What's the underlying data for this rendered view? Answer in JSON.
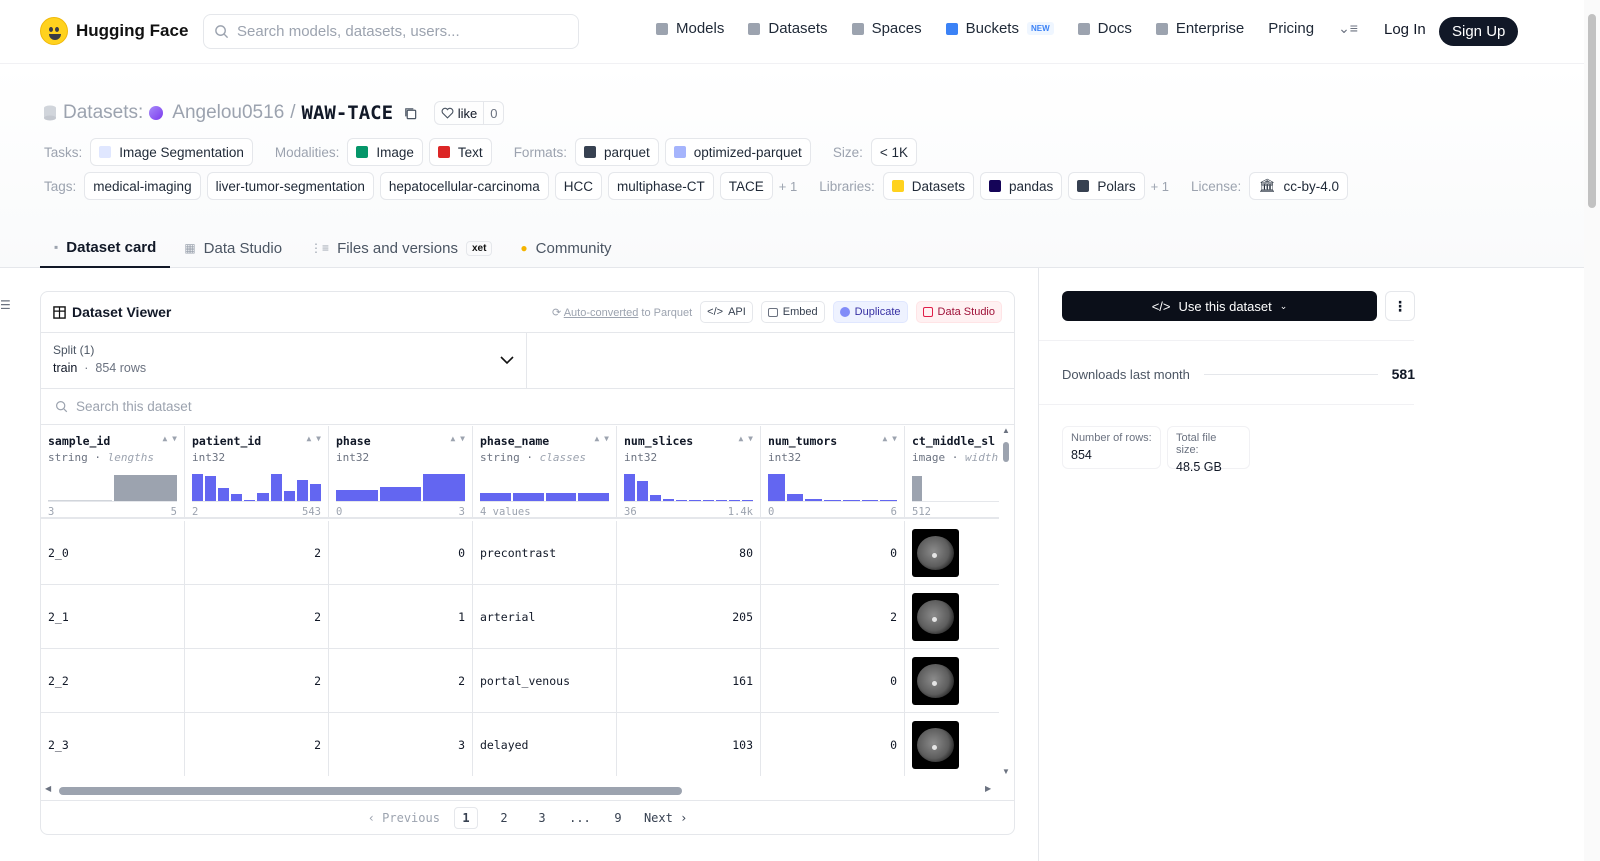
{
  "nav": {
    "brand": "Hugging Face",
    "search_placeholder": "Search models, datasets, users...",
    "links": [
      {
        "label": "Models",
        "icon": "cube-icon",
        "color": "#9ca3af"
      },
      {
        "label": "Datasets",
        "icon": "database-icon",
        "color": "#9ca3af"
      },
      {
        "label": "Spaces",
        "icon": "grid-icon",
        "color": "#9ca3af"
      },
      {
        "label": "Buckets",
        "icon": "bucket-icon",
        "color": "#3b82f6",
        "badge": "NEW"
      },
      {
        "label": "Docs",
        "icon": "book-icon",
        "color": "#9ca3af"
      },
      {
        "label": "Enterprise",
        "icon": "enterprise-icon",
        "color": "#9ca3af"
      },
      {
        "label": "Pricing"
      }
    ],
    "login": "Log In",
    "signup": "Sign Up"
  },
  "repo": {
    "prefix": "Datasets:",
    "owner": "Angelou0516",
    "sep": "/",
    "name": "WAW-TACE",
    "like": "like",
    "likes": "0"
  },
  "meta": {
    "tasks_label": "Tasks:",
    "tasks": [
      "Image Segmentation"
    ],
    "modalities_label": "Modalities:",
    "modalities": [
      "Image",
      "Text"
    ],
    "formats_label": "Formats:",
    "formats": [
      "parquet",
      "optimized-parquet"
    ],
    "size_label": "Size:",
    "size": "< 1K",
    "tags_label": "Tags:",
    "tags": [
      "medical-imaging",
      "liver-tumor-segmentation",
      "hepatocellular-carcinoma",
      "HCC",
      "multiphase-CT",
      "TACE"
    ],
    "tags_more": "+ 1",
    "libraries_label": "Libraries:",
    "libraries": [
      "Datasets",
      "pandas",
      "Polars"
    ],
    "libraries_more": "+ 1",
    "license_label": "License:",
    "license": "cc-by-4.0"
  },
  "tabs": [
    {
      "label": "Dataset card",
      "active": true
    },
    {
      "label": "Data Studio"
    },
    {
      "label": "Files and versions",
      "badge": "xet"
    },
    {
      "label": "Community"
    }
  ],
  "viewer": {
    "title": "Dataset Viewer",
    "auto_link": "Auto-converted",
    "auto_rest": "to Parquet",
    "buttons": [
      "API",
      "Embed",
      "Duplicate",
      "Data Studio"
    ],
    "split_label": "Split (1)",
    "split_name": "train",
    "split_rows": "854 rows",
    "search_placeholder": "Search this dataset",
    "columns": [
      {
        "name": "sample_id",
        "type": "string",
        "stat": "lengths",
        "min": "3",
        "max": "5"
      },
      {
        "name": "patient_id",
        "type": "int32",
        "min": "2",
        "max": "543"
      },
      {
        "name": "phase",
        "type": "int32",
        "min": "0",
        "max": "3"
      },
      {
        "name": "phase_name",
        "type": "string",
        "stat": "classes",
        "min": "4 values",
        "max": ""
      },
      {
        "name": "num_slices",
        "type": "int32",
        "min": "36",
        "max": "1.4k"
      },
      {
        "name": "num_tumors",
        "type": "int32",
        "min": "0",
        "max": "6"
      },
      {
        "name": "ct_middle_sl",
        "type": "image",
        "stat": "width",
        "min": "512",
        "max": ""
      }
    ],
    "histograms": [
      [
        0.0,
        0.92
      ],
      [
        0.95,
        0.9,
        0.45,
        0.25,
        0.0,
        0.28,
        0.95,
        0.35,
        0.75,
        0.6
      ],
      [
        0.4,
        0.5,
        0.95
      ],
      [
        0.28,
        0.28,
        0.28,
        0.28
      ],
      [
        0.95,
        0.72,
        0.2,
        0.06,
        0.04,
        0.02,
        0.0,
        0.0,
        0.0,
        0.02
      ],
      [
        0.95,
        0.25,
        0.08,
        0.04,
        0.04,
        0.04,
        0.04
      ],
      [
        0.9
      ]
    ],
    "rows": [
      [
        "2_0",
        "2",
        "0",
        "precontrast",
        "80",
        "0"
      ],
      [
        "2_1",
        "2",
        "1",
        "arterial",
        "205",
        "2"
      ],
      [
        "2_2",
        "2",
        "2",
        "portal_venous",
        "161",
        "0"
      ],
      [
        "2_3",
        "2",
        "3",
        "delayed",
        "103",
        "0"
      ]
    ],
    "pager": {
      "prev": "Previous",
      "pages": [
        "1",
        "2",
        "3",
        "...",
        "9"
      ],
      "next": "Next"
    }
  },
  "side": {
    "use_btn": "Use this dataset",
    "downloads_label": "Downloads last month",
    "downloads": "581",
    "rows_label": "Number of rows:",
    "rows": "854",
    "filesize_label": "Total file size:",
    "filesize": "48.5 GB"
  }
}
